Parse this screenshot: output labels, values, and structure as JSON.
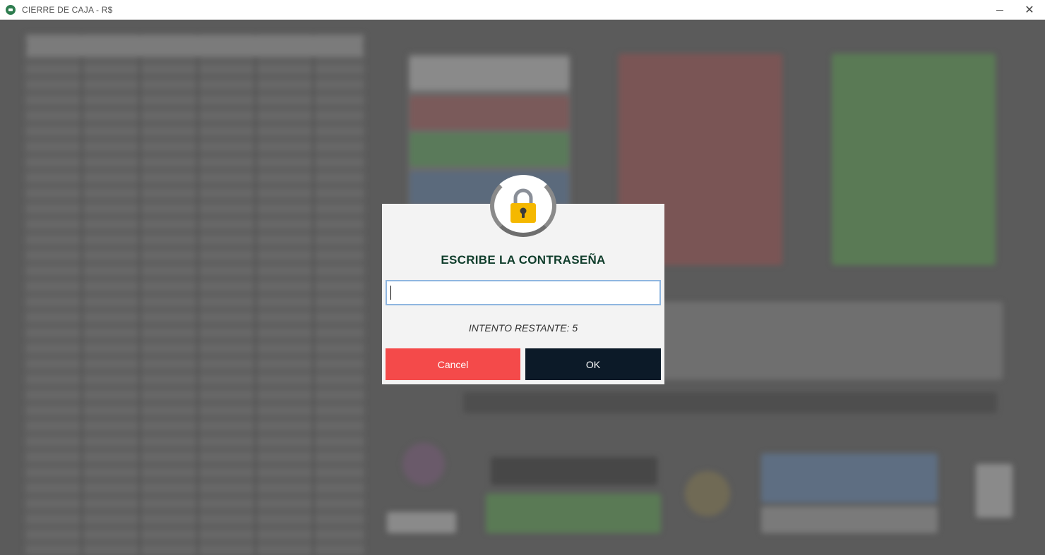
{
  "window": {
    "title": "CIERRE DE CAJA - R$",
    "minimize_glyph": "—",
    "close_glyph": "✕"
  },
  "dialog": {
    "icon": "lock-icon",
    "title": "ESCRIBE LA CONTRASEÑA",
    "password_value": "",
    "attempts_text": "INTENTO RESTANTE: 5",
    "cancel_label": "Cancel",
    "ok_label": "OK"
  },
  "colors": {
    "title_text": "#0f3d2b",
    "cancel_button": "#f44a4a",
    "ok_button": "#0c1a28",
    "lock_body": "#f5b800",
    "input_focus_border": "#8fb6e0"
  }
}
